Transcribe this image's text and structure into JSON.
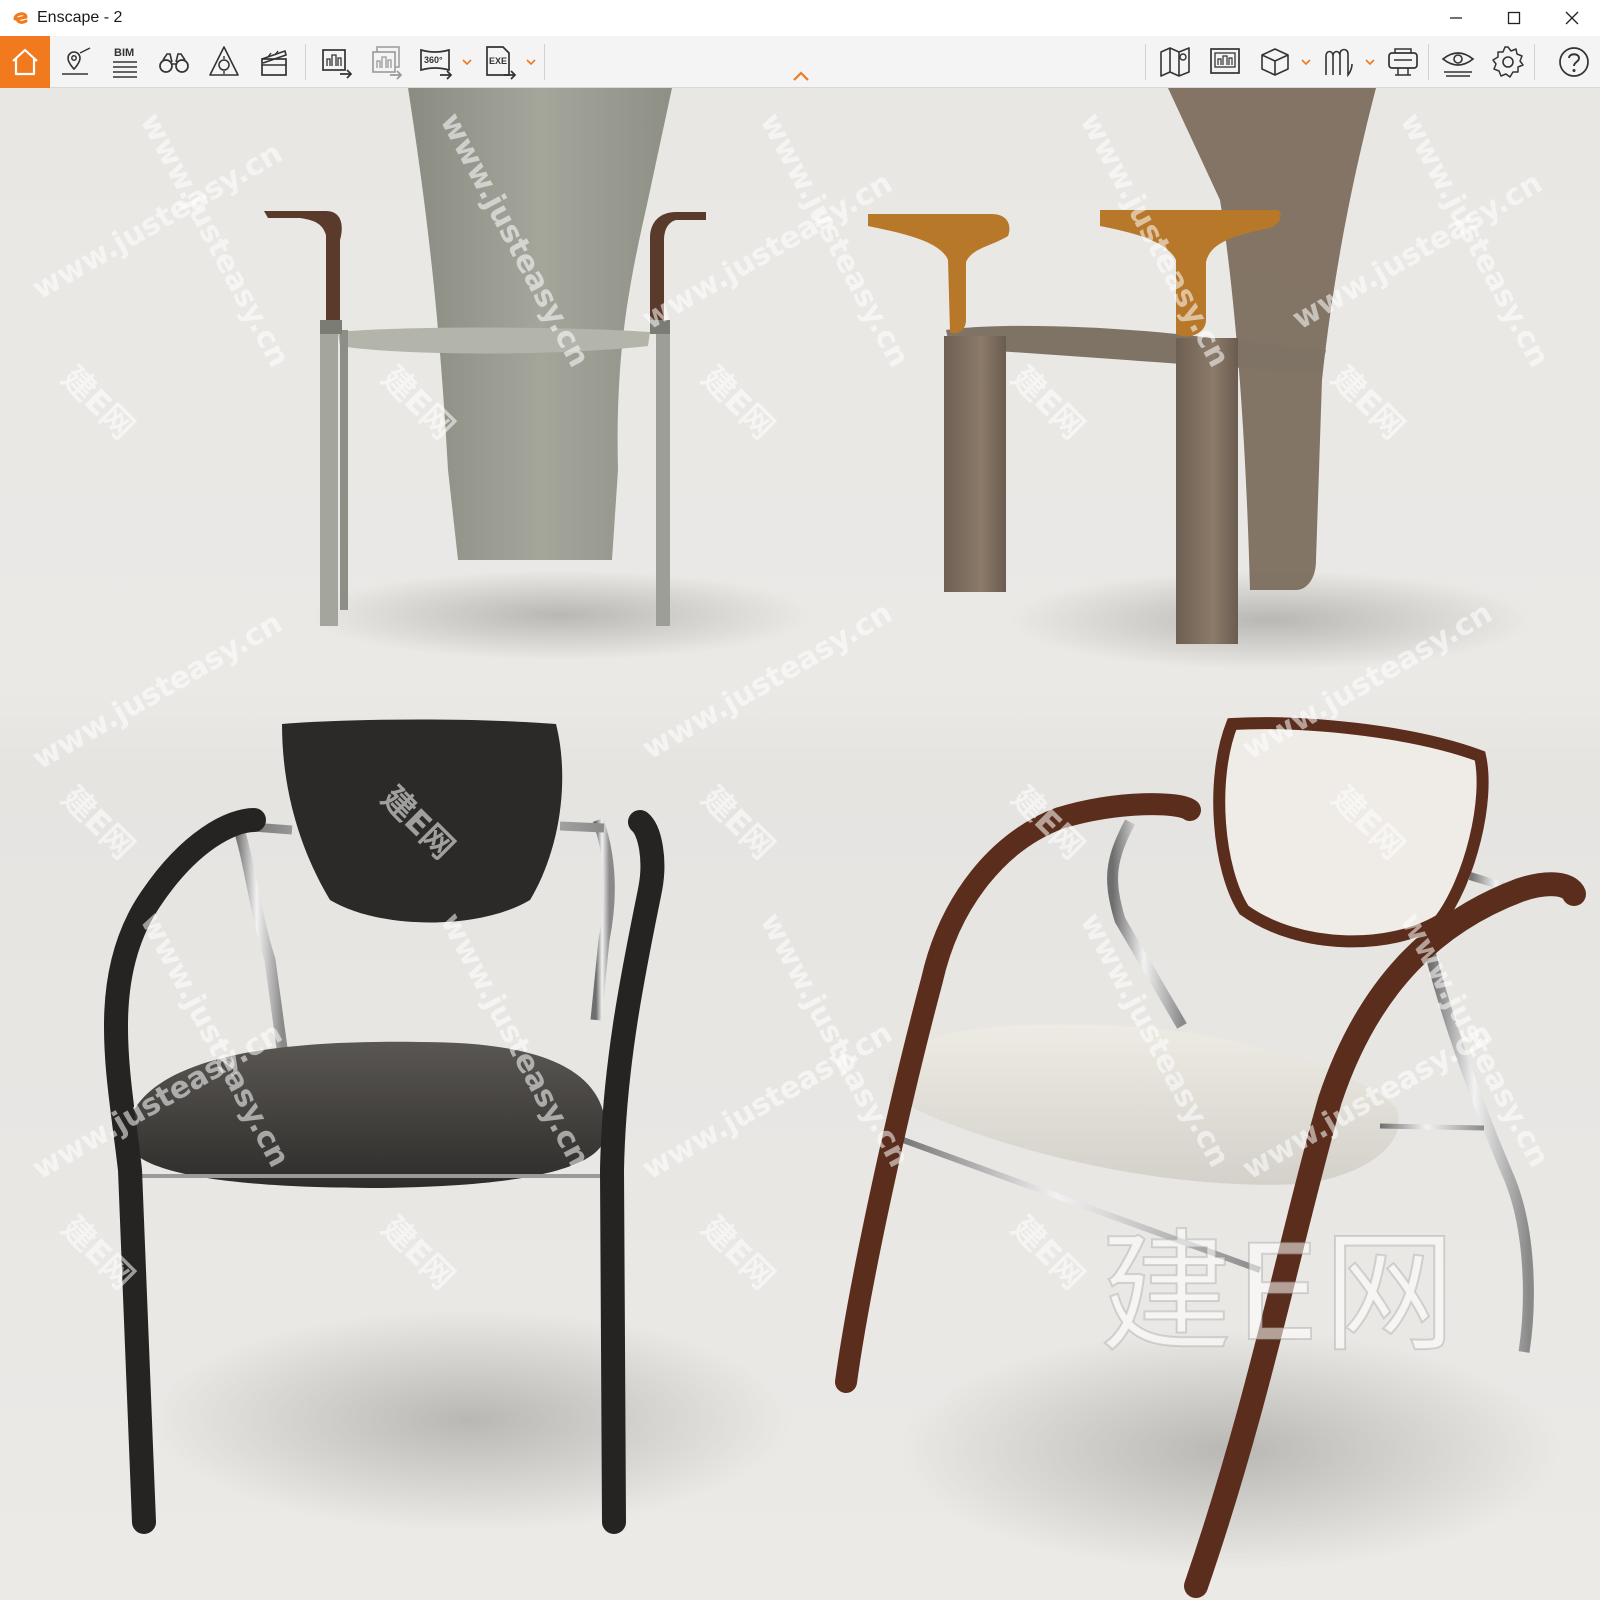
{
  "window": {
    "title": "Enscape - 2",
    "controls": [
      "minimize",
      "maximize",
      "close"
    ]
  },
  "toolbar": {
    "home_icon": "home-icon",
    "left_tools": [
      {
        "name": "views-icon"
      },
      {
        "name": "bim-icon",
        "label": "BIM"
      },
      {
        "name": "binoculars-icon"
      },
      {
        "name": "atmosphere-icon"
      },
      {
        "name": "video-editor-icon"
      },
      {
        "name": "export-image-icon"
      },
      {
        "name": "batch-export-icon"
      },
      {
        "name": "export-360-icon",
        "label": "360°"
      },
      {
        "name": "export-exe-icon",
        "label": "EXE"
      }
    ],
    "right_tools": [
      {
        "name": "map-icon"
      },
      {
        "name": "sheet-icon"
      },
      {
        "name": "asset-box-icon"
      },
      {
        "name": "asset-library-icon"
      },
      {
        "name": "vr-headset-icon"
      },
      {
        "name": "visibility-icon"
      },
      {
        "name": "settings-gear-icon"
      },
      {
        "name": "help-icon"
      }
    ],
    "accent_color": "#f07a1d"
  },
  "viewport": {
    "scene": "rendered-chairs",
    "watermark_text": "www.justeasy.cn",
    "watermark_logo": "建E网"
  }
}
